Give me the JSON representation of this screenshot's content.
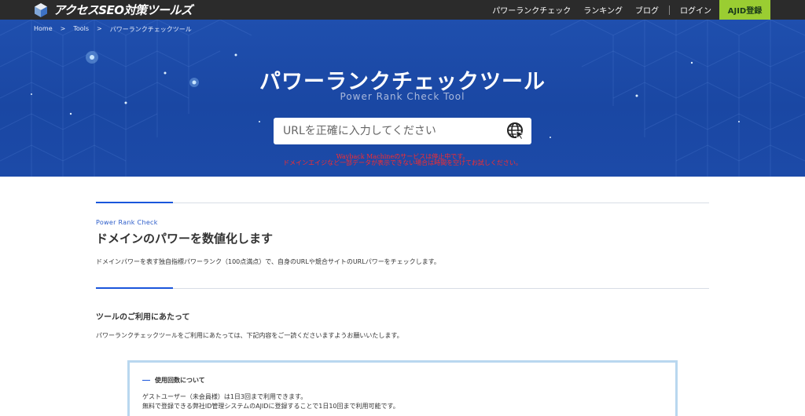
{
  "header": {
    "logo_text": "アクセスSEO対策ツールズ",
    "nav": {
      "power_rank": "パワーランクチェック",
      "ranking": "ランキング",
      "blog": "ブログ",
      "login": "ログイン",
      "register": "AJID登録"
    },
    "colors": {
      "bar": "#2b2b2b",
      "register_button": "#9acd32"
    }
  },
  "breadcrumb": {
    "home": "Home",
    "sep1": ">",
    "tools": "Tools",
    "sep2": ">",
    "current": "パワーランクチェックツール"
  },
  "hero": {
    "title": "パワーランクチェックツール",
    "subtitle": "Power Rank Check Tool",
    "search_placeholder": "URLを正確に入力してください",
    "search_icon": "globe-cursor-icon",
    "notice_line1": "Wayback Machineのサービスは停止中です。",
    "notice_line2": "ドメインエイジなど一部データが表示できない場合は時間を空けてお試しください。",
    "colors": {
      "background": "#1f4fae",
      "notice": "#ff2a2a"
    }
  },
  "section": {
    "label": "Power Rank Check",
    "title": "ドメインのパワーを数値化します",
    "description": "ドメインパワーを表す独自指標パワーランク（100点満点）で、自身のURLや競合サイトのURLパワーをチェックします。"
  },
  "usage": {
    "title": "ツールのご利用にあたって",
    "description": "パワーランクチェックツールをご利用にあたっては、下記内容をご一読くださいますようお願いいたします。"
  },
  "info_box": {
    "heading": "使用回数について",
    "line1": "ゲストユーザー（未会員様）は1日3回まで利用できます。",
    "line2": "無料で登録できる弊社ID管理システムのAJIDに登録することで1日10回まで利用可能です。"
  }
}
